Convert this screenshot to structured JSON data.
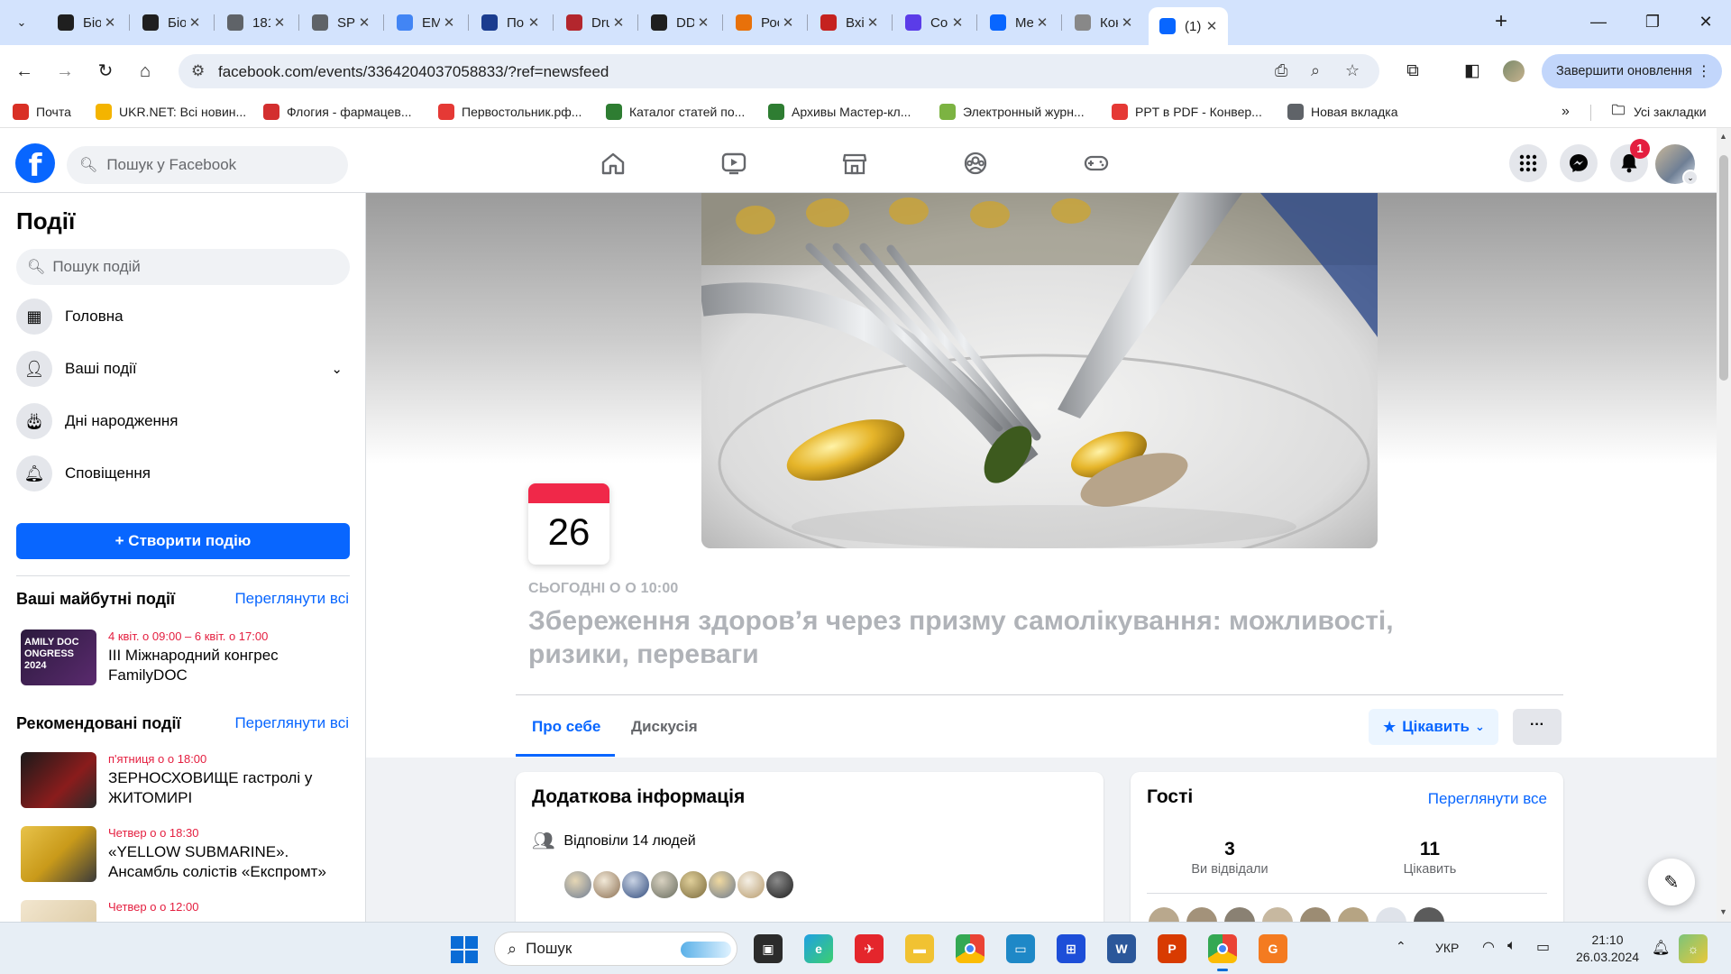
{
  "browser": {
    "tabs": [
      {
        "title": "Біо",
        "favicon": "bookmark-icon",
        "color": "#1f1f1f"
      },
      {
        "title": "Біо",
        "favicon": "lock-icon",
        "color": "#1f1f1f"
      },
      {
        "title": "181",
        "favicon": "globe-icon",
        "color": "#5f6368"
      },
      {
        "title": "SP8",
        "favicon": "globe-icon",
        "color": "#5f6368"
      },
      {
        "title": "EM/",
        "favicon": "google-icon",
        "color": "#4285f4"
      },
      {
        "title": "Пош",
        "favicon": "blue-circle-icon",
        "color": "#1a3c8f"
      },
      {
        "title": "Dru",
        "favicon": "drugs-icon",
        "color": "#b3262d"
      },
      {
        "title": "DD(",
        "favicon": "lock-icon",
        "color": "#1f1f1f"
      },
      {
        "title": "Рос",
        "favicon": "e-icon",
        "color": "#e8710a"
      },
      {
        "title": "Вхід",
        "favicon": "mail-icon",
        "color": "#c5221f"
      },
      {
        "title": "Cor",
        "favicon": "app-icon",
        "color": "#5b3ce8"
      },
      {
        "title": "Met",
        "favicon": "meta-icon",
        "color": "#0866ff"
      },
      {
        "title": "Кон",
        "favicon": "swirl-icon",
        "color": "#888888"
      },
      {
        "title": "(1) :",
        "favicon": "facebook-icon",
        "color": "#0866ff",
        "active": true
      }
    ],
    "url": "facebook.com/events/3364204037058833/?ref=newsfeed",
    "update_label": "Завершити оновлення",
    "bookmarks": [
      {
        "label": "Почта",
        "icon": "mail-icon",
        "color": "#d93025"
      },
      {
        "label": "UKR.NET: Всі новин...",
        "icon": "ukrnet-icon",
        "color": "#f4b400"
      },
      {
        "label": "Флогия - фармацев...",
        "icon": "red-arrow-icon",
        "color": "#d32f2f"
      },
      {
        "label": "Первостольник.рф...",
        "icon": "grid-icon",
        "color": "#e53935"
      },
      {
        "label": "Каталог статей по...",
        "icon": "leaf-icon",
        "color": "#2e7d32"
      },
      {
        "label": "Архивы Мастер-кл...",
        "icon": "cross-icon",
        "color": "#2e7d32"
      },
      {
        "label": "Электронный журн...",
        "icon": "hand-icon",
        "color": "#7cb342"
      },
      {
        "label": "PPT в PDF - Конвер...",
        "icon": "squares-icon",
        "color": "#e53935"
      },
      {
        "label": "Новая вкладка",
        "icon": "globe-icon",
        "color": "#5f6368"
      }
    ],
    "all_bookmarks_label": "Усі закладки"
  },
  "fb": {
    "search_placeholder": "Пошук у Facebook",
    "notif_count": "1"
  },
  "sidebar": {
    "title": "Події",
    "search_placeholder": "Пошук подій",
    "items": [
      {
        "label": "Головна",
        "icon": "calendar-grid-icon"
      },
      {
        "label": "Ваші події",
        "icon": "person-icon"
      },
      {
        "label": "Дні народження",
        "icon": "cake-icon"
      },
      {
        "label": "Сповіщення",
        "icon": "bell-icon"
      }
    ],
    "create_label": "+ Створити подію",
    "upcoming_title": "Ваші майбутні події",
    "recommended_title": "Рекомендовані події",
    "see_all": "Переглянути всі",
    "upcoming": [
      {
        "date": "4 квіт. о 09:00 – 6 квіт. о 17:00",
        "name": "III Міжнародний конгрес FamilyDOC",
        "thumb_text": "AMILY DOC ONGRESS 2024"
      }
    ],
    "recommended": [
      {
        "date": "п'ятниця о о 18:00",
        "name": "ЗЕРНОСХОВИЩЕ гастролі у ЖИТОМИРІ"
      },
      {
        "date": "Четвер о о 18:30",
        "name": "«YELLOW SUBMARINE». Ансамбль солістів «Експромт»"
      },
      {
        "date": "Четвер о о 12:00",
        "name": ""
      }
    ]
  },
  "event": {
    "day": "26",
    "when": "СЬОГОДНІ О О 10:00",
    "title": "Збереження здоров’я через призму самолікування: можливості, ризики, переваги",
    "tabs": [
      "Про себе",
      "Дискусія"
    ],
    "interested_label": "Цікавить",
    "more_label": "···",
    "info_title": "Додаткова інформація",
    "responded": "Відповіли 14 людей",
    "guests_title": "Гості",
    "guests_link": "Переглянути все",
    "went_count": "3",
    "went_label": "Ви відвідали",
    "interested_count": "11",
    "interested_stat_label": "Цікавить"
  },
  "taskbar": {
    "search_label": "Пошук",
    "lang": "УКР",
    "time": "21:10",
    "date": "26.03.2024"
  }
}
